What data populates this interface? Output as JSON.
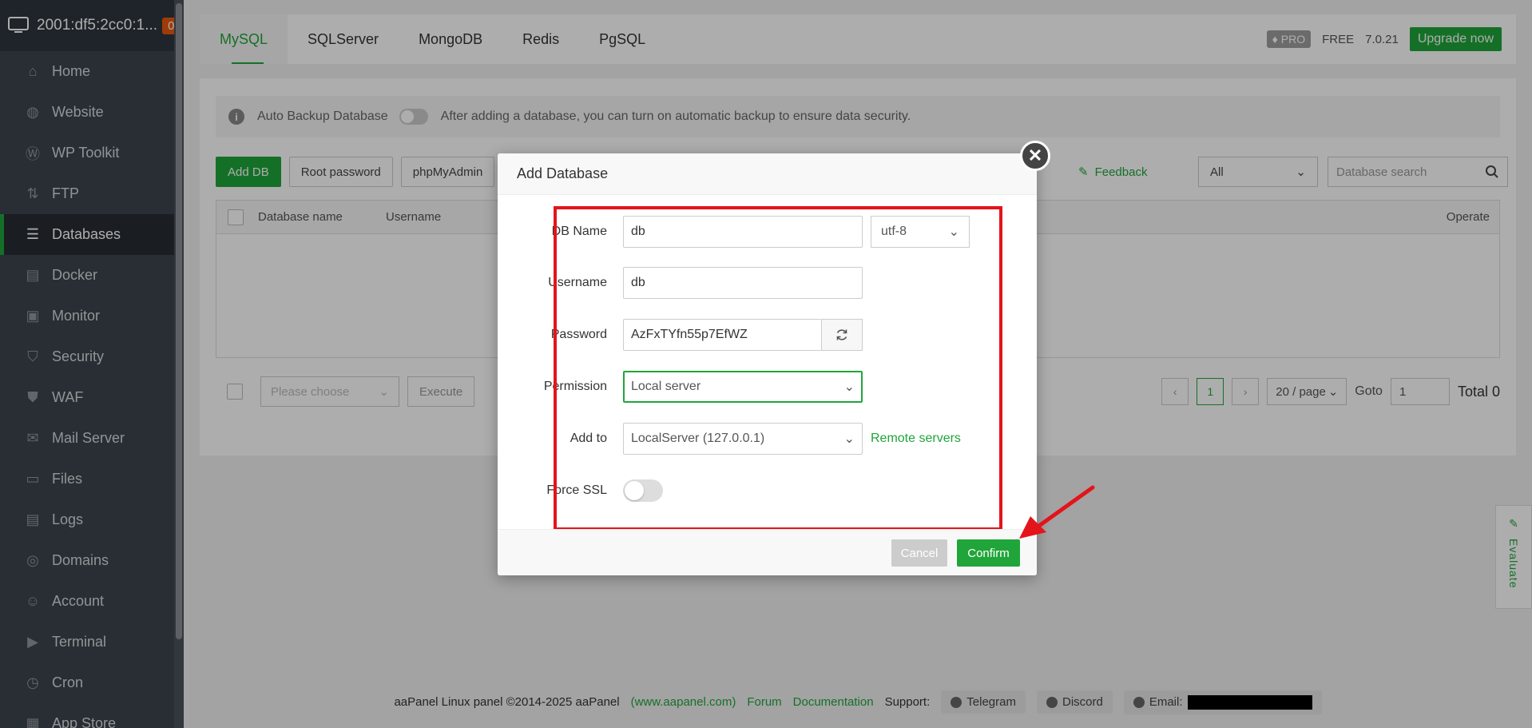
{
  "server": {
    "name": "2001:df5:2cc0:1...",
    "badge": "0"
  },
  "sidebar": {
    "items": [
      {
        "label": "Home",
        "icon": "home-icon"
      },
      {
        "label": "Website",
        "icon": "globe-icon"
      },
      {
        "label": "WP Toolkit",
        "icon": "wordpress-icon"
      },
      {
        "label": "FTP",
        "icon": "ftp-icon"
      },
      {
        "label": "Databases",
        "icon": "database-icon",
        "active": true
      },
      {
        "label": "Docker",
        "icon": "docker-icon"
      },
      {
        "label": "Monitor",
        "icon": "monitor-icon"
      },
      {
        "label": "Security",
        "icon": "shield-icon"
      },
      {
        "label": "WAF",
        "icon": "waf-shield-icon"
      },
      {
        "label": "Mail Server",
        "icon": "mail-icon"
      },
      {
        "label": "Files",
        "icon": "folder-icon"
      },
      {
        "label": "Logs",
        "icon": "logs-icon"
      },
      {
        "label": "Domains",
        "icon": "domains-icon"
      },
      {
        "label": "Account",
        "icon": "user-icon"
      },
      {
        "label": "Terminal",
        "icon": "terminal-icon"
      },
      {
        "label": "Cron",
        "icon": "cron-icon"
      },
      {
        "label": "App Store",
        "icon": "app-store-icon"
      }
    ]
  },
  "tabs": [
    "MySQL",
    "SQLServer",
    "MongoDB",
    "Redis",
    "PgSQL"
  ],
  "header": {
    "pro": "PRO",
    "free": "FREE",
    "version": "7.0.21",
    "upgrade": "Upgrade now"
  },
  "alert": {
    "label": "Auto Backup Database",
    "text": "After adding a database, you can turn on automatic backup to ensure data security."
  },
  "toolbar": {
    "add_db": "Add DB",
    "root_password": "Root password",
    "phpmyadmin": "phpMyAdmin",
    "feedback": "Feedback",
    "filter": "All",
    "search_placeholder": "Database search"
  },
  "table": {
    "col_name": "Database name",
    "col_user": "Username",
    "col_operate": "Operate"
  },
  "footer": {
    "batch_placeholder": "Please choose",
    "execute": "Execute",
    "page": "1",
    "per_page": "20 / page",
    "goto_label": "Goto",
    "goto_value": "1",
    "total": "Total 0"
  },
  "copyright": {
    "text": "aaPanel Linux panel ©2014-2025 aaPanel",
    "site": "(www.aapanel.com)",
    "forum": "Forum",
    "docs": "Documentation",
    "support": "Support:",
    "telegram": "Telegram",
    "discord": "Discord",
    "email": "Email:"
  },
  "evaluate": "Evaluate",
  "modal": {
    "title": "Add Database",
    "db_name_label": "DB Name",
    "db_name": "db",
    "charset": "utf-8",
    "username_label": "Username",
    "username": "db",
    "password_label": "Password",
    "password": "AzFxTYfn55p7EfWZ",
    "permission_label": "Permission",
    "permission": "Local server",
    "add_to_label": "Add to",
    "add_to": "LocalServer (127.0.0.1)",
    "remote_servers": "Remote servers",
    "force_ssl_label": "Force SSL",
    "cancel": "Cancel",
    "confirm": "Confirm"
  },
  "colors": {
    "accent": "#20a53a",
    "sidebar": "#3c444d",
    "highlight": "#e4141b"
  }
}
